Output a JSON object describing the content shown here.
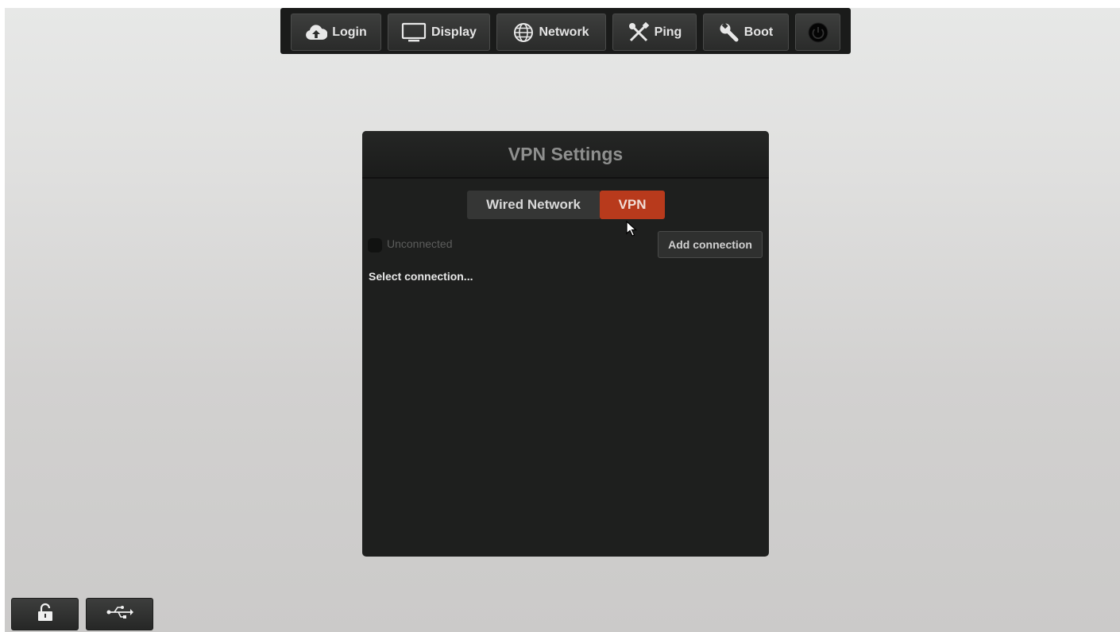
{
  "toolbar": {
    "login": {
      "label": "Login",
      "icon": "cloud-upload-icon"
    },
    "display": {
      "label": "Display",
      "icon": "monitor-icon"
    },
    "network": {
      "label": "Network",
      "icon": "globe-icon"
    },
    "ping": {
      "label": "Ping",
      "icon": "tools-icon"
    },
    "boot": {
      "label": "Boot",
      "icon": "wrench-icon"
    },
    "power": {
      "icon": "power-icon"
    }
  },
  "dialog": {
    "title": "VPN Settings",
    "tabs": [
      {
        "label": "Wired Network",
        "active": false
      },
      {
        "label": "VPN",
        "active": true
      }
    ],
    "status": "Unconnected",
    "add_connection_label": "Add connection",
    "select_connection_text": "Select connection..."
  },
  "bottom_bar": {
    "lock": {
      "icon": "lock-icon"
    },
    "usb": {
      "icon": "usb-icon"
    }
  },
  "colors": {
    "accent_active_tab": "#b83a1c",
    "dialog_background": "#1e1f1e",
    "toolbar_background": "#1a1b1a"
  }
}
